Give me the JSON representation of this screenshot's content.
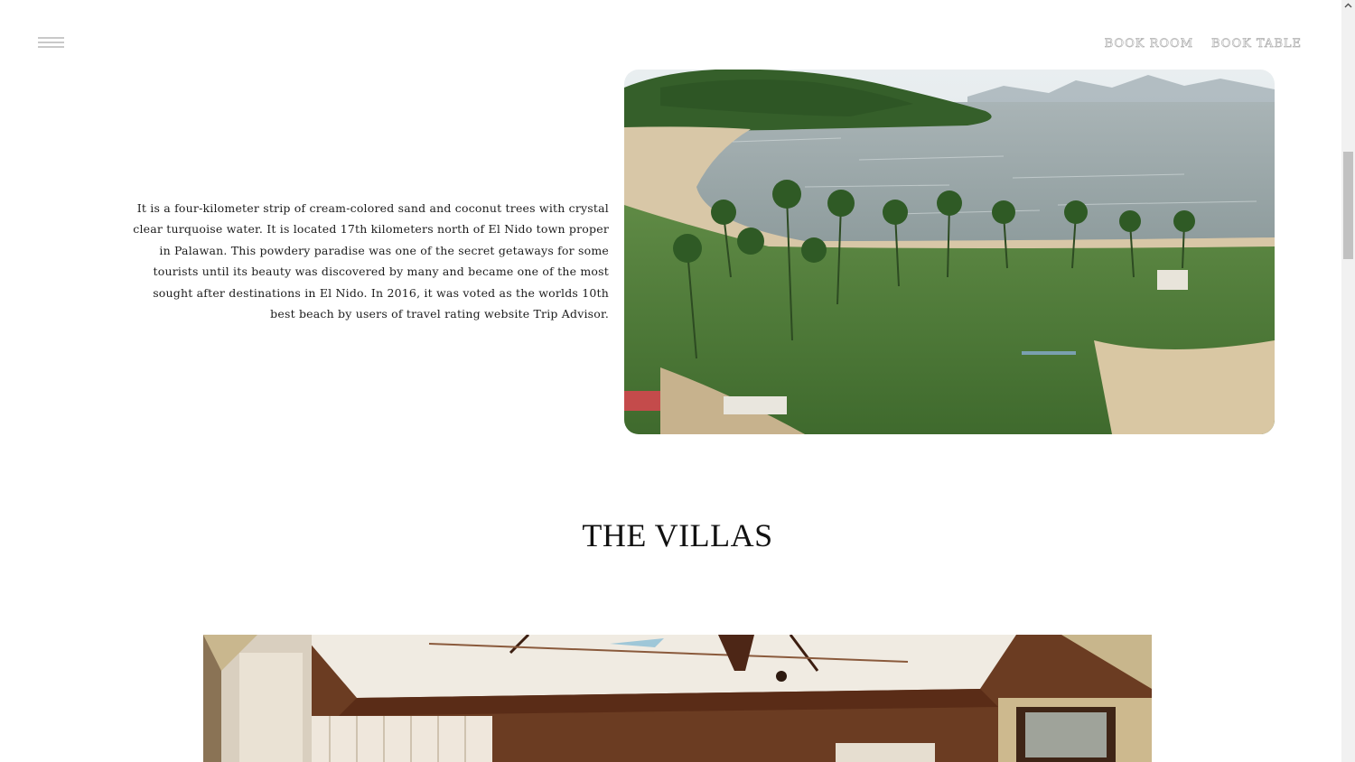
{
  "header": {
    "menu_icon": "hamburger-menu-icon",
    "nav": [
      {
        "label": "BOOK ROOM"
      },
      {
        "label": "BOOK TABLE"
      }
    ]
  },
  "beach": {
    "description": "It is a four-kilometer strip of cream-colored sand and coconut trees with crystal clear turquoise water. It is located 17th kilometers north of El Nido town proper in Palawan. This powdery paradise was one of the secret getaways for some tourists until its beauty was discovered by many and became one of the most sought after destinations in El Nido. In 2016, it was voted as the worlds 10th best beach by users of travel rating website Trip Advisor."
  },
  "villas": {
    "heading": "THE VILLAS"
  },
  "colors": {
    "background": "#ffffff",
    "text": "#1c1c1c",
    "nav_outline": "#b5b5b5"
  }
}
